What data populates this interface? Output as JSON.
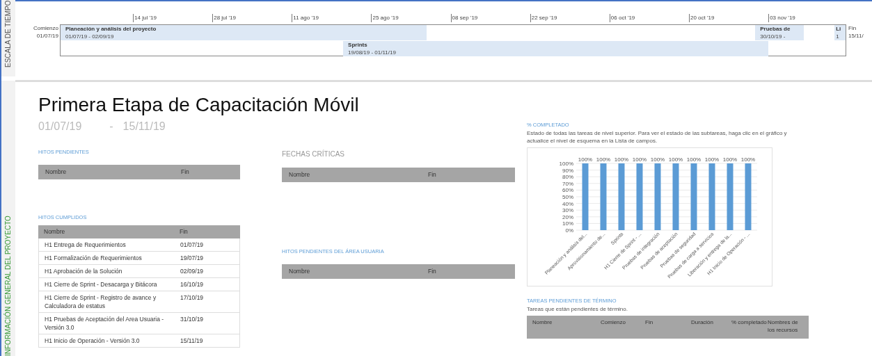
{
  "side_labels": {
    "timeline": "ESCALA DE TIEMPO",
    "overview": "INFORMACIÓN GENERAL DEL PROYECTO"
  },
  "timeline": {
    "start_label": "Comienzo",
    "start_date": "01/07/19",
    "end_label": "Fin",
    "end_date": "15/11/",
    "ticks": [
      "14 jul '19",
      "28 jul '19",
      "11 ago '19",
      "25 ago '19",
      "08 sep '19",
      "22 sep '19",
      "06 oct '19",
      "20 oct '19",
      "03 nov '19"
    ],
    "bars": [
      {
        "name": "Planeación y análisis del proyecto",
        "dates": "01/07/19 - 02/09/19"
      },
      {
        "name": "Sprints",
        "dates": "19/08/19 - 01/11/19"
      },
      {
        "name": "Pruebas de",
        "dates": "30/10/19 -"
      },
      {
        "name": "Li",
        "dates": "1"
      }
    ]
  },
  "title": "Primera Etapa de Capacitación Móvil",
  "dates": {
    "start": "01/07/19",
    "separator": "-",
    "end": "15/11/19"
  },
  "hitos_pendientes": {
    "heading": "HITOS PENDIENTES",
    "columns": [
      "Nombre",
      "Fin"
    ]
  },
  "hitos_cumplidos": {
    "heading": "HITOS CUMPLIDOS",
    "columns": [
      "Nombre",
      "Fin"
    ],
    "rows": [
      [
        "H1 Entrega de Requerimientos",
        "01/07/19"
      ],
      [
        "H1 Formalización de Requerimientos",
        "19/07/19"
      ],
      [
        "H1 Aprobación de la Solución",
        "02/09/19"
      ],
      [
        "H1 Cierre de Sprint - Desacarga y Bitácora",
        "16/10/19"
      ],
      [
        "H1 Cierre de Sprint - Registro de avance y Calculadora de estatus",
        "17/10/19"
      ],
      [
        "H1 Pruebas de Aceptación del Area Usuaria - Versión 3.0",
        "31/10/19"
      ],
      [
        "H1 Inicio de Operación - Versión 3.0",
        "15/11/19"
      ]
    ]
  },
  "fechas_criticas": {
    "heading": "FECHAS CRÍTICAS",
    "columns": [
      "Nombre",
      "Fin"
    ]
  },
  "hitos_area_usuaria": {
    "heading": "HITOS PENDIENTES DEL ÁREA USUARIA",
    "columns": [
      "Nombre",
      "Fin"
    ]
  },
  "completado": {
    "heading": "% COMPLETADO",
    "description": "Estado de todas las tareas de nivel superior. Para ver el estado de las subtareas, haga clic en el gráfico y actualice el nivel de esquema en la Lista de campos.",
    "chart_data": {
      "type": "bar",
      "categories": [
        "Planeación y análisis del...",
        "Aprovisionamiento de...",
        "Sprints",
        "H1 Cierre de Sprint - ...",
        "Pruebas de integración",
        "Pruebas de aceptación",
        "Pruebas de seguridad",
        "Pruebas de carga a servicios",
        "Liberación y entrega de la...",
        "H1 Inicio de Operación - ..."
      ],
      "values": [
        100,
        100,
        100,
        100,
        100,
        100,
        100,
        100,
        100,
        100
      ],
      "value_labels": [
        "100%",
        "100%",
        "100%",
        "100%",
        "100%",
        "100%",
        "100%",
        "100%",
        "100%",
        "100%"
      ],
      "grid": true,
      "ylim": [
        0,
        100
      ],
      "yticks": [
        {
          "value": 0,
          "label": "0%"
        },
        {
          "value": 10,
          "label": "10%"
        },
        {
          "value": 20,
          "label": "20%"
        },
        {
          "value": 30,
          "label": "30%"
        },
        {
          "value": 40,
          "label": "40%"
        },
        {
          "value": 50,
          "label": "50%"
        },
        {
          "value": 60,
          "label": "60%"
        },
        {
          "value": 70,
          "label": "70%"
        },
        {
          "value": 80,
          "label": "80%"
        },
        {
          "value": 90,
          "label": "90%"
        },
        {
          "value": 100,
          "label": "100%"
        }
      ]
    }
  },
  "tareas_pendientes": {
    "heading": "TAREAS PENDIENTES DE TÉRMINO",
    "description": "Tareas que están pendientes de término.",
    "columns": [
      "Nombre",
      "Comienzo",
      "Fin",
      "Duración",
      "% completado",
      "Nombres de los recursos"
    ]
  }
}
